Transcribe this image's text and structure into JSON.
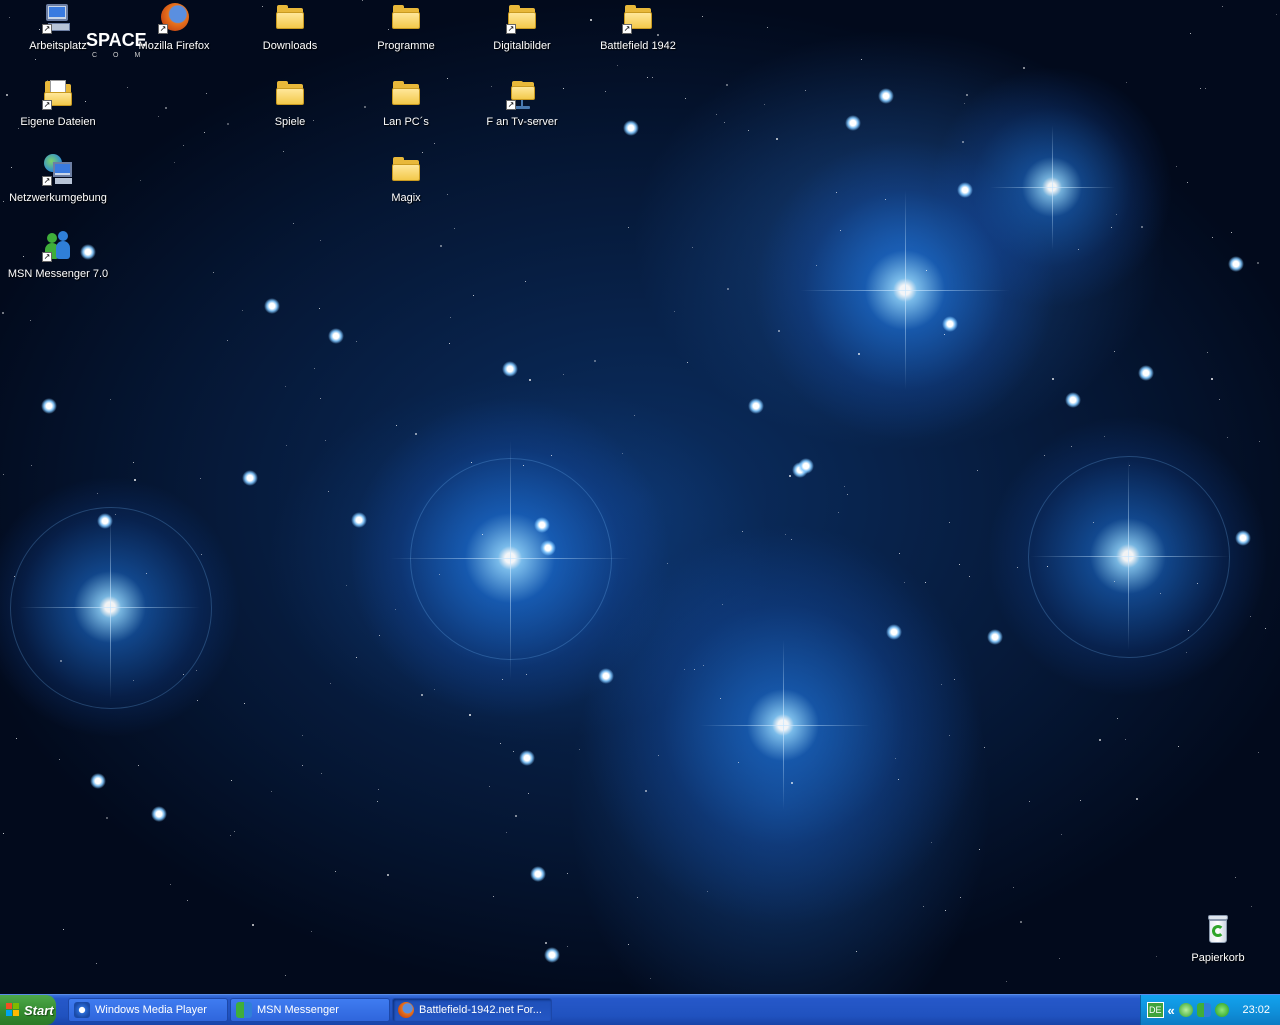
{
  "desktop": {
    "logo": {
      "text": "SPACE",
      "sub": "COM"
    },
    "icons": [
      {
        "label": "Arbeitsplatz",
        "icon": "computer-icon",
        "shortcut": true
      },
      {
        "label": "Mozilla Firefox",
        "icon": "firefox-icon",
        "shortcut": true
      },
      {
        "label": "Downloads",
        "icon": "folder-icon",
        "shortcut": false
      },
      {
        "label": "Programme",
        "icon": "folder-icon",
        "shortcut": false
      },
      {
        "label": "Digitalbilder",
        "icon": "folder-icon",
        "shortcut": true
      },
      {
        "label": "Battlefield 1942",
        "icon": "folder-icon",
        "shortcut": true
      },
      {
        "label": "Eigene Dateien",
        "icon": "documents-icon",
        "shortcut": true
      },
      {
        "label": "Spiele",
        "icon": "folder-icon",
        "shortcut": false
      },
      {
        "label": "Lan PC´s",
        "icon": "folder-icon",
        "shortcut": false
      },
      {
        "label": "F an Tv-server",
        "icon": "network-share-icon",
        "shortcut": true
      },
      {
        "label": "Netzwerkumgebung",
        "icon": "network-places-icon",
        "shortcut": true
      },
      {
        "label": "Magix",
        "icon": "folder-icon",
        "shortcut": false
      },
      {
        "label": "MSN Messenger 7.0",
        "icon": "msn-messenger-icon",
        "shortcut": true
      },
      {
        "label": "Papierkorb",
        "icon": "recycle-bin-icon",
        "shortcut": false
      }
    ]
  },
  "taskbar": {
    "start_label": "Start",
    "tasks": [
      {
        "label": "Windows Media Player",
        "icon": "media-player-icon",
        "active": false
      },
      {
        "label": "MSN Messenger",
        "icon": "msn-messenger-icon",
        "active": false
      },
      {
        "label": "Battlefield-1942.net For...",
        "icon": "firefox-icon",
        "active": true
      }
    ],
    "tray": {
      "language": "DE",
      "expand": "«",
      "icons": [
        "shield-check-icon",
        "msn-buddy-icon",
        "clover-icon"
      ],
      "clock": "23:02"
    }
  },
  "colors": {
    "taskbar": "#2052bf",
    "start": "#328a2e",
    "tray": "#0f8ed8"
  }
}
